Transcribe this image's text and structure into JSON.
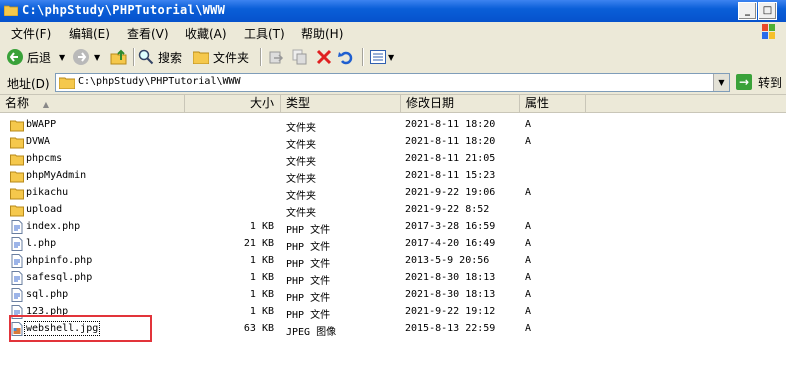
{
  "window": {
    "title": "C:\\phpStudy\\PHPTutorial\\WWW"
  },
  "menu": [
    "文件(F)",
    "编辑(E)",
    "查看(V)",
    "收藏(A)",
    "工具(T)",
    "帮助(H)"
  ],
  "toolbar": {
    "back_label": "后退",
    "search_label": "搜索",
    "folders_label": "文件夹"
  },
  "address": {
    "label": "地址(D)",
    "value": "C:\\phpStudy\\PHPTutorial\\WWW",
    "go_label": "转到"
  },
  "columns": {
    "name": "名称",
    "size": "大小",
    "type": "类型",
    "modified": "修改日期",
    "attributes": "属性"
  },
  "files": [
    {
      "name": "bWAPP",
      "size": "",
      "type": "文件夹",
      "modified": "2021-8-11 18:20",
      "attr": "A",
      "icon": "folder-icon"
    },
    {
      "name": "DVWA",
      "size": "",
      "type": "文件夹",
      "modified": "2021-8-11 18:20",
      "attr": "A",
      "icon": "folder-icon"
    },
    {
      "name": "phpcms",
      "size": "",
      "type": "文件夹",
      "modified": "2021-8-11 21:05",
      "attr": "",
      "icon": "folder-icon"
    },
    {
      "name": "phpMyAdmin",
      "size": "",
      "type": "文件夹",
      "modified": "2021-8-11 15:23",
      "attr": "",
      "icon": "folder-icon"
    },
    {
      "name": "pikachu",
      "size": "",
      "type": "文件夹",
      "modified": "2021-9-22 19:06",
      "attr": "A",
      "icon": "folder-icon"
    },
    {
      "name": "upload",
      "size": "",
      "type": "文件夹",
      "modified": "2021-9-22 8:52",
      "attr": "",
      "icon": "folder-icon"
    },
    {
      "name": "index.php",
      "size": "1 KB",
      "type": "PHP 文件",
      "modified": "2017-3-28 16:59",
      "attr": "A",
      "icon": "php-file-icon"
    },
    {
      "name": "l.php",
      "size": "21 KB",
      "type": "PHP 文件",
      "modified": "2017-4-20 16:49",
      "attr": "A",
      "icon": "php-file-icon"
    },
    {
      "name": "phpinfo.php",
      "size": "1 KB",
      "type": "PHP 文件",
      "modified": "2013-5-9 20:56",
      "attr": "A",
      "icon": "php-file-icon"
    },
    {
      "name": "safesql.php",
      "size": "1 KB",
      "type": "PHP 文件",
      "modified": "2021-8-30 18:13",
      "attr": "A",
      "icon": "php-file-icon"
    },
    {
      "name": "sql.php",
      "size": "1 KB",
      "type": "PHP 文件",
      "modified": "2021-8-30 18:13",
      "attr": "A",
      "icon": "php-file-icon"
    },
    {
      "name": "123.php",
      "size": "1 KB",
      "type": "PHP 文件",
      "modified": "2021-9-22 19:12",
      "attr": "A",
      "icon": "php-file-icon"
    },
    {
      "name": "webshell.jpg",
      "size": "63 KB",
      "type": "JPEG 图像",
      "modified": "2015-8-13 22:59",
      "attr": "A",
      "icon": "image-file-icon"
    }
  ],
  "colors": {
    "titlebar": "#0a5fd8",
    "chrome": "#ece9d8",
    "highlight_box": "#e2343a",
    "folder": "#f5c84c"
  }
}
